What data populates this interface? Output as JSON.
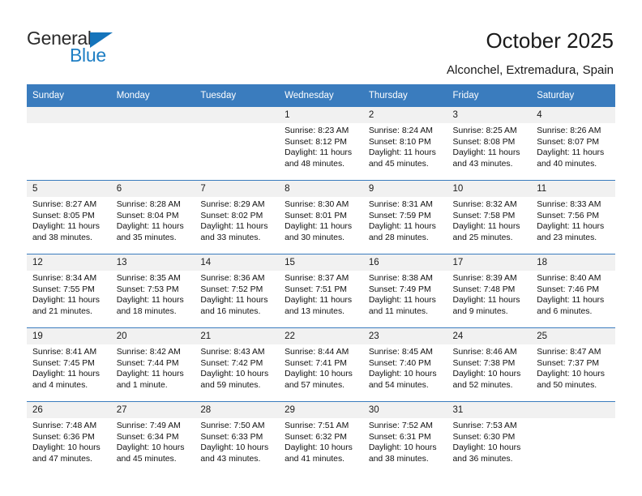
{
  "brand": {
    "name_top": "General",
    "name_bottom": "Blue",
    "triangle_color": "#1574bb",
    "blue_text_color": "#1f7fc4"
  },
  "header": {
    "title": "October 2025",
    "subtitle": "Alconchel, Extremadura, Spain"
  },
  "theme": {
    "header_band": "#3a7cbe",
    "daynum_strip": "#f1f1f1",
    "text": "#111111"
  },
  "weekdays": [
    "Sunday",
    "Monday",
    "Tuesday",
    "Wednesday",
    "Thursday",
    "Friday",
    "Saturday"
  ],
  "labels": {
    "sunrise_prefix": "Sunrise:",
    "sunset_prefix": "Sunset:",
    "daylight_prefix": "Daylight:"
  },
  "weeks": [
    [
      {
        "day": "",
        "empty": true
      },
      {
        "day": "",
        "empty": true
      },
      {
        "day": "",
        "empty": true
      },
      {
        "day": "1",
        "sunrise": "Sunrise: 8:23 AM",
        "sunset": "Sunset: 8:12 PM",
        "daylight_line1": "Daylight: 11 hours",
        "daylight_line2": "and 48 minutes."
      },
      {
        "day": "2",
        "sunrise": "Sunrise: 8:24 AM",
        "sunset": "Sunset: 8:10 PM",
        "daylight_line1": "Daylight: 11 hours",
        "daylight_line2": "and 45 minutes."
      },
      {
        "day": "3",
        "sunrise": "Sunrise: 8:25 AM",
        "sunset": "Sunset: 8:08 PM",
        "daylight_line1": "Daylight: 11 hours",
        "daylight_line2": "and 43 minutes."
      },
      {
        "day": "4",
        "sunrise": "Sunrise: 8:26 AM",
        "sunset": "Sunset: 8:07 PM",
        "daylight_line1": "Daylight: 11 hours",
        "daylight_line2": "and 40 minutes."
      }
    ],
    [
      {
        "day": "5",
        "sunrise": "Sunrise: 8:27 AM",
        "sunset": "Sunset: 8:05 PM",
        "daylight_line1": "Daylight: 11 hours",
        "daylight_line2": "and 38 minutes."
      },
      {
        "day": "6",
        "sunrise": "Sunrise: 8:28 AM",
        "sunset": "Sunset: 8:04 PM",
        "daylight_line1": "Daylight: 11 hours",
        "daylight_line2": "and 35 minutes."
      },
      {
        "day": "7",
        "sunrise": "Sunrise: 8:29 AM",
        "sunset": "Sunset: 8:02 PM",
        "daylight_line1": "Daylight: 11 hours",
        "daylight_line2": "and 33 minutes."
      },
      {
        "day": "8",
        "sunrise": "Sunrise: 8:30 AM",
        "sunset": "Sunset: 8:01 PM",
        "daylight_line1": "Daylight: 11 hours",
        "daylight_line2": "and 30 minutes."
      },
      {
        "day": "9",
        "sunrise": "Sunrise: 8:31 AM",
        "sunset": "Sunset: 7:59 PM",
        "daylight_line1": "Daylight: 11 hours",
        "daylight_line2": "and 28 minutes."
      },
      {
        "day": "10",
        "sunrise": "Sunrise: 8:32 AM",
        "sunset": "Sunset: 7:58 PM",
        "daylight_line1": "Daylight: 11 hours",
        "daylight_line2": "and 25 minutes."
      },
      {
        "day": "11",
        "sunrise": "Sunrise: 8:33 AM",
        "sunset": "Sunset: 7:56 PM",
        "daylight_line1": "Daylight: 11 hours",
        "daylight_line2": "and 23 minutes."
      }
    ],
    [
      {
        "day": "12",
        "sunrise": "Sunrise: 8:34 AM",
        "sunset": "Sunset: 7:55 PM",
        "daylight_line1": "Daylight: 11 hours",
        "daylight_line2": "and 21 minutes."
      },
      {
        "day": "13",
        "sunrise": "Sunrise: 8:35 AM",
        "sunset": "Sunset: 7:53 PM",
        "daylight_line1": "Daylight: 11 hours",
        "daylight_line2": "and 18 minutes."
      },
      {
        "day": "14",
        "sunrise": "Sunrise: 8:36 AM",
        "sunset": "Sunset: 7:52 PM",
        "daylight_line1": "Daylight: 11 hours",
        "daylight_line2": "and 16 minutes."
      },
      {
        "day": "15",
        "sunrise": "Sunrise: 8:37 AM",
        "sunset": "Sunset: 7:51 PM",
        "daylight_line1": "Daylight: 11 hours",
        "daylight_line2": "and 13 minutes."
      },
      {
        "day": "16",
        "sunrise": "Sunrise: 8:38 AM",
        "sunset": "Sunset: 7:49 PM",
        "daylight_line1": "Daylight: 11 hours",
        "daylight_line2": "and 11 minutes."
      },
      {
        "day": "17",
        "sunrise": "Sunrise: 8:39 AM",
        "sunset": "Sunset: 7:48 PM",
        "daylight_line1": "Daylight: 11 hours",
        "daylight_line2": "and 9 minutes."
      },
      {
        "day": "18",
        "sunrise": "Sunrise: 8:40 AM",
        "sunset": "Sunset: 7:46 PM",
        "daylight_line1": "Daylight: 11 hours",
        "daylight_line2": "and 6 minutes."
      }
    ],
    [
      {
        "day": "19",
        "sunrise": "Sunrise: 8:41 AM",
        "sunset": "Sunset: 7:45 PM",
        "daylight_line1": "Daylight: 11 hours",
        "daylight_line2": "and 4 minutes."
      },
      {
        "day": "20",
        "sunrise": "Sunrise: 8:42 AM",
        "sunset": "Sunset: 7:44 PM",
        "daylight_line1": "Daylight: 11 hours",
        "daylight_line2": "and 1 minute."
      },
      {
        "day": "21",
        "sunrise": "Sunrise: 8:43 AM",
        "sunset": "Sunset: 7:42 PM",
        "daylight_line1": "Daylight: 10 hours",
        "daylight_line2": "and 59 minutes."
      },
      {
        "day": "22",
        "sunrise": "Sunrise: 8:44 AM",
        "sunset": "Sunset: 7:41 PM",
        "daylight_line1": "Daylight: 10 hours",
        "daylight_line2": "and 57 minutes."
      },
      {
        "day": "23",
        "sunrise": "Sunrise: 8:45 AM",
        "sunset": "Sunset: 7:40 PM",
        "daylight_line1": "Daylight: 10 hours",
        "daylight_line2": "and 54 minutes."
      },
      {
        "day": "24",
        "sunrise": "Sunrise: 8:46 AM",
        "sunset": "Sunset: 7:38 PM",
        "daylight_line1": "Daylight: 10 hours",
        "daylight_line2": "and 52 minutes."
      },
      {
        "day": "25",
        "sunrise": "Sunrise: 8:47 AM",
        "sunset": "Sunset: 7:37 PM",
        "daylight_line1": "Daylight: 10 hours",
        "daylight_line2": "and 50 minutes."
      }
    ],
    [
      {
        "day": "26",
        "sunrise": "Sunrise: 7:48 AM",
        "sunset": "Sunset: 6:36 PM",
        "daylight_line1": "Daylight: 10 hours",
        "daylight_line2": "and 47 minutes."
      },
      {
        "day": "27",
        "sunrise": "Sunrise: 7:49 AM",
        "sunset": "Sunset: 6:34 PM",
        "daylight_line1": "Daylight: 10 hours",
        "daylight_line2": "and 45 minutes."
      },
      {
        "day": "28",
        "sunrise": "Sunrise: 7:50 AM",
        "sunset": "Sunset: 6:33 PM",
        "daylight_line1": "Daylight: 10 hours",
        "daylight_line2": "and 43 minutes."
      },
      {
        "day": "29",
        "sunrise": "Sunrise: 7:51 AM",
        "sunset": "Sunset: 6:32 PM",
        "daylight_line1": "Daylight: 10 hours",
        "daylight_line2": "and 41 minutes."
      },
      {
        "day": "30",
        "sunrise": "Sunrise: 7:52 AM",
        "sunset": "Sunset: 6:31 PM",
        "daylight_line1": "Daylight: 10 hours",
        "daylight_line2": "and 38 minutes."
      },
      {
        "day": "31",
        "sunrise": "Sunrise: 7:53 AM",
        "sunset": "Sunset: 6:30 PM",
        "daylight_line1": "Daylight: 10 hours",
        "daylight_line2": "and 36 minutes."
      },
      {
        "day": "",
        "empty": true,
        "blank": true
      }
    ]
  ]
}
